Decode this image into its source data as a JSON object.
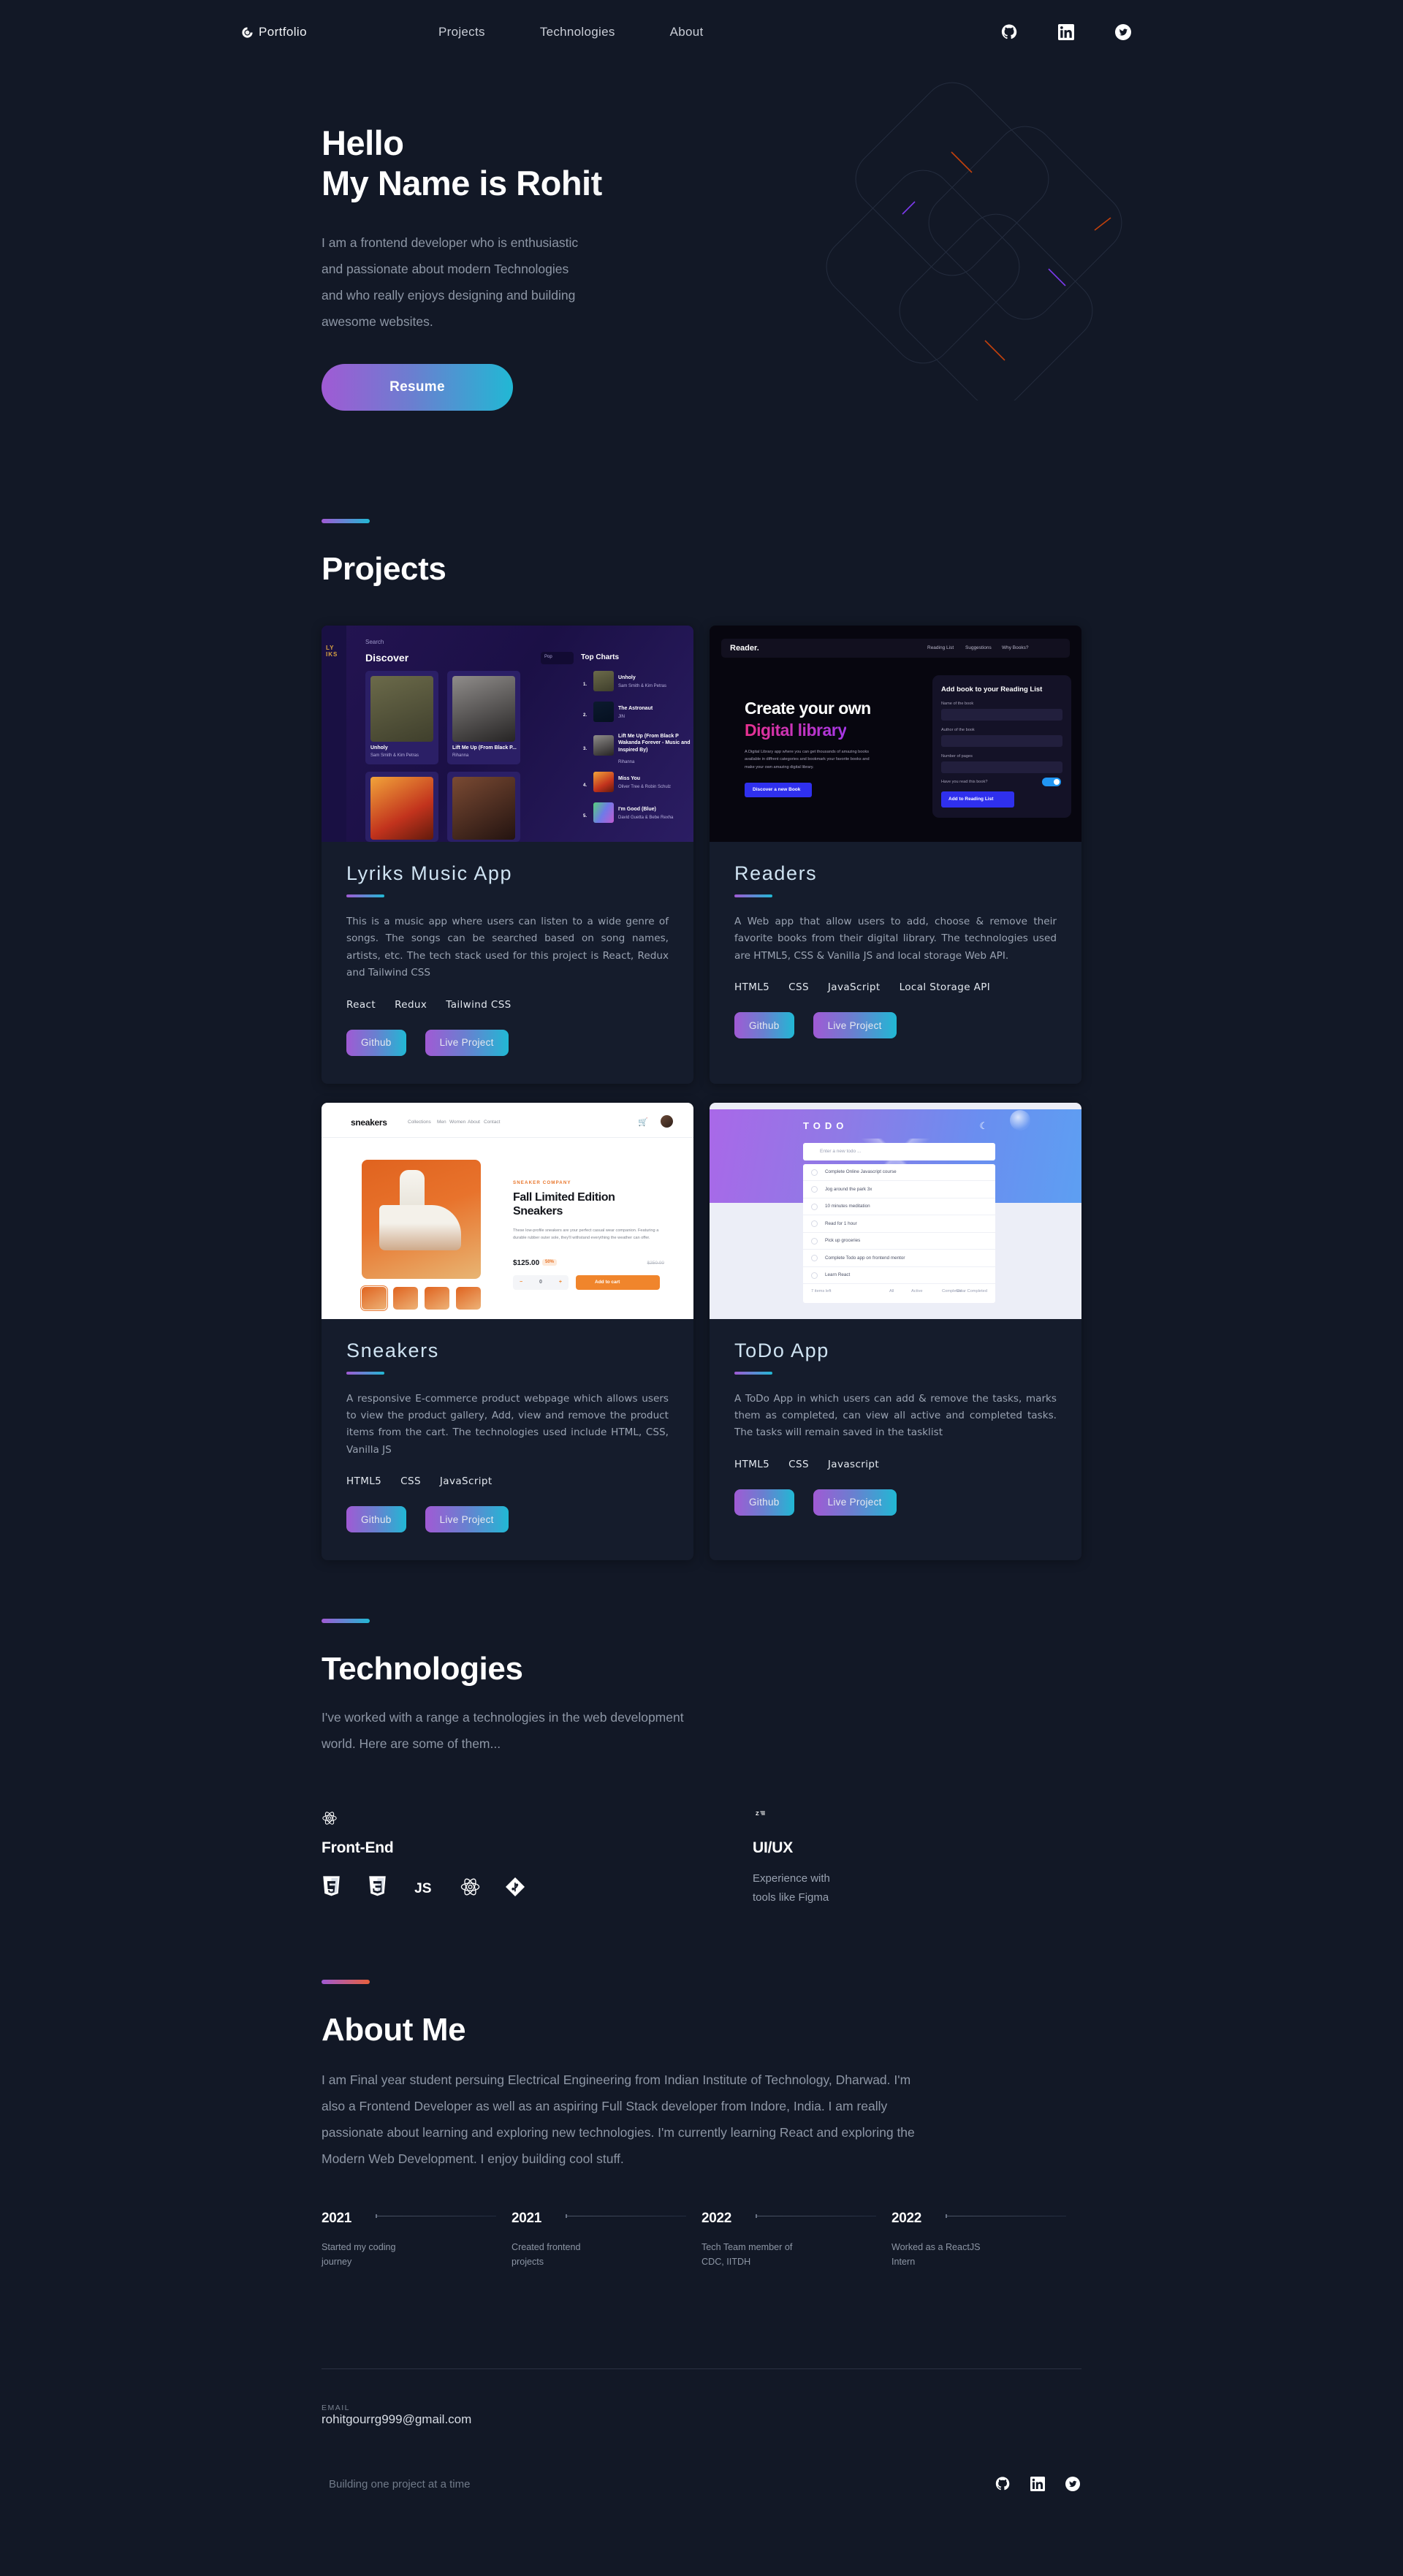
{
  "header": {
    "brand": "Portfolio",
    "brand_icon": "circle-logo-icon",
    "nav": [
      {
        "label": "Projects"
      },
      {
        "label": "Technologies"
      },
      {
        "label": "About"
      }
    ],
    "socials": [
      {
        "name": "github-icon"
      },
      {
        "name": "linkedin-icon"
      },
      {
        "name": "twitter-icon"
      }
    ]
  },
  "hero": {
    "title": "Hello\nMy Name is Rohit",
    "description": "I am a frontend developer who is enthusiastic\nand passionate about modern Technologies\nand who really enjoys designing and building\nawesome websites.",
    "cta_label": "Resume"
  },
  "projects": {
    "section_title": "Projects",
    "items": [
      {
        "name": "Lyriks Music App",
        "description": "This is a music app where users can listen to a wide genre of songs. The songs can be searched based on song names, artists, etc. The tech stack used for this project is React, Redux and Tailwind CSS",
        "tags": [
          "React",
          "Redux",
          "Tailwind CSS"
        ],
        "github_label": "Github",
        "live_label": "Live Project",
        "thumb": {
          "kind": "lyriks",
          "search_placeholder": "Search",
          "heading": "Discover",
          "genre": "Pop",
          "charts_title": "Top Charts",
          "cards": [
            {
              "title": "Unholy",
              "artist": "Sam Smith & Kim Petras"
            },
            {
              "title": "Lift Me Up (From Black P...",
              "artist": "Rihanna"
            }
          ],
          "chart_rows": [
            {
              "n": "1.",
              "title": "Unholy",
              "artist": "Sam Smith & Kim Petras"
            },
            {
              "n": "2.",
              "title": "The Astronaut",
              "artist": "JIN"
            },
            {
              "n": "3.",
              "title": "Lift Me Up (From Black P Wakanda Forever - Music and Inspired By)",
              "artist": "Rihanna"
            },
            {
              "n": "4.",
              "title": "Miss You",
              "artist": "Oliver Tree & Robin Schulz"
            },
            {
              "n": "5.",
              "title": "I'm Good (Blue)",
              "artist": "David Guetta & Bebe Rexha"
            }
          ]
        }
      },
      {
        "name": "Readers",
        "description": "A Web app that allow users to add, choose & remove their favorite books from their digital library. The technologies used are HTML5, CSS & Vanilla JS and local storage Web API.",
        "tags": [
          "HTML5",
          "CSS",
          "JavaScript",
          "Local Storage API"
        ],
        "github_label": "Github",
        "live_label": "Live Project",
        "thumb": {
          "kind": "readers",
          "logo": "Reader.",
          "nav": [
            "Reading List",
            "Suggestions",
            "Why Books?"
          ],
          "headline_1": "Create your own",
          "headline_2": "Digital library",
          "paragraph": "A Digital Library app where you can get thousands of amazing books available in diffrent categories and bookmark your favorite books and make your own amazing digital library.",
          "cta": "Discover a new Book",
          "panel_title": "Add book to your Reading List",
          "fields": [
            "Name of the book",
            "Author of the book",
            "Number of pages"
          ],
          "toggle_label": "Have you read this book?",
          "panel_cta": "Add to Reading List"
        }
      },
      {
        "name": "Sneakers",
        "description": "A responsive E-commerce product webpage which allows users to view the product gallery, Add, view and remove the product items from the cart. The technologies used include HTML, CSS, Vanilla JS",
        "tags": [
          "HTML5",
          "CSS",
          "JavaScript"
        ],
        "github_label": "Github",
        "live_label": "Live Project",
        "thumb": {
          "kind": "sneakers",
          "logo": "sneakers",
          "nav": [
            "Collections",
            "Men",
            "Women",
            "About",
            "Contact"
          ],
          "eyebrow": "SNEAKER COMPANY",
          "title": "Fall Limited Edition Sneakers",
          "paragraph": "These low-profile sneakers are your perfect casual wear companion. Featuring a durable rubber outer sole, they'll withstand everything the weather can offer.",
          "price": "$125.00",
          "discount": "50%",
          "old_price": "$250.00",
          "qty": "0",
          "add_label": "Add to cart"
        }
      },
      {
        "name": "ToDo App",
        "description": "A ToDo App in which users can add & remove the tasks, marks them as completed, can view all active and completed tasks. The tasks will remain saved in the tasklist",
        "tags": [
          "HTML5",
          "CSS",
          "Javascript"
        ],
        "github_label": "Github",
        "live_label": "Live Project",
        "thumb": {
          "kind": "todo",
          "heading": "TODO",
          "input_placeholder": "Enter a new todo ...",
          "tasks": [
            "Complete Online Javascript course",
            "Jog around the park 3x",
            "10 minutes meditation",
            "Read for 1 hour",
            "Pick up groceries",
            "Complete Todo app on frontend mentor",
            "Learn React"
          ],
          "footer": {
            "count": "7 items left",
            "filters": [
              "All",
              "Active",
              "Completed"
            ],
            "clear": "Clear Completed"
          }
        }
      }
    ]
  },
  "technologies": {
    "section_title": "Technologies",
    "subtitle": "I've worked with a range a technologies in the web development\nworld. Here are some of them...",
    "columns": [
      {
        "icon": "react-atom-icon",
        "heading": "Front-End",
        "logos": [
          "html5-icon",
          "css3-icon",
          "javascript-icon",
          "react-icon",
          "git-icon"
        ],
        "note": ""
      },
      {
        "icon": "zeplin-icon",
        "heading": "UI/UX",
        "logos": [],
        "note": "Experience with\ntools like Figma"
      }
    ]
  },
  "about": {
    "section_title": "About Me",
    "text": "I am Final year student persuing Electrical Engineering from Indian Institute of Technology, Dharwad. I'm also a Frontend Developer as well as an aspiring Full Stack developer from Indore, India. I am really passionate about learning and exploring new technologies. I'm currently learning React and exploring the Modern Web Development. I enjoy building cool stuff.",
    "timeline": [
      {
        "year": "2021",
        "desc": "Started my coding\njourney"
      },
      {
        "year": "2021",
        "desc": "Created frontend\nprojects"
      },
      {
        "year": "2022",
        "desc": "Tech Team member of\nCDC, IITDH"
      },
      {
        "year": "2022",
        "desc": "Worked as a ReactJS\nIntern"
      }
    ]
  },
  "footer": {
    "email_label": "EMAIL",
    "email": "rohitgourrg999@gmail.com",
    "tagline": "Building one project at a time",
    "socials": [
      {
        "name": "github-icon"
      },
      {
        "name": "linkedin-icon"
      },
      {
        "name": "twitter-icon"
      }
    ]
  },
  "colors": {
    "background": "#121826",
    "card": "#151c2c",
    "accent_purple": "#a05ad4",
    "accent_cyan": "#21b8d4",
    "accent_orange": "#e8603c",
    "project_title": "#cfe3f2",
    "muted_text": "#8d96a5"
  }
}
